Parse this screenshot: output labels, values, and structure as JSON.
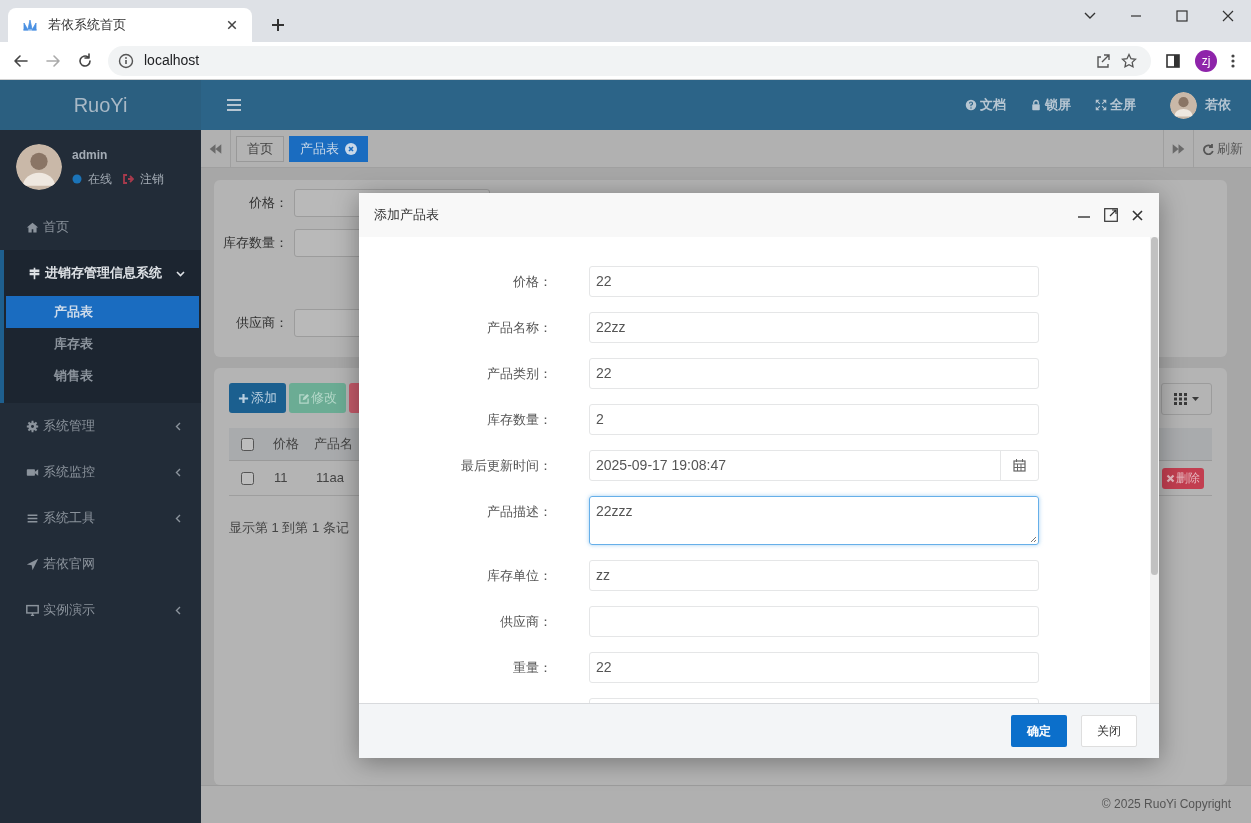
{
  "browser": {
    "tab_title": "若依系统首页",
    "url": "localhost",
    "profile_initials": "zj"
  },
  "header": {
    "logo": "RuoYi",
    "links": [
      {
        "label": "文档"
      },
      {
        "label": "锁屏"
      },
      {
        "label": "全屏"
      }
    ],
    "user_name": "若依"
  },
  "sidebar": {
    "user": {
      "name": "admin",
      "status": "在线",
      "logout": "注销"
    },
    "items": [
      {
        "kind": "link",
        "label": "首页"
      },
      {
        "kind": "menu",
        "label": "进销存管理信息系统",
        "expanded": true,
        "children": [
          {
            "label": "产品表",
            "selected": true
          },
          {
            "label": "库存表",
            "selected": false
          },
          {
            "label": "销售表",
            "selected": false
          }
        ]
      },
      {
        "kind": "menu",
        "label": "系统管理",
        "expanded": false
      },
      {
        "kind": "menu",
        "label": "系统监控",
        "expanded": false
      },
      {
        "kind": "menu",
        "label": "系统工具",
        "expanded": false
      },
      {
        "kind": "link",
        "label": "若依官网"
      },
      {
        "kind": "menu",
        "label": "实例演示",
        "expanded": false
      }
    ]
  },
  "page_tabs": [
    {
      "label": "首页",
      "selected": false,
      "closable": false
    },
    {
      "label": "产品表",
      "selected": true,
      "closable": true
    }
  ],
  "refresh": "刷新",
  "search_form": {
    "labels": [
      "价格：",
      "库存数量：",
      "供应商："
    ]
  },
  "toolbar": [
    {
      "kind": "primary",
      "label": "添加"
    },
    {
      "kind": "success",
      "label": "修改"
    },
    {
      "kind": "danger"
    }
  ],
  "table": {
    "header_checked": false,
    "columns": [
      "价格",
      "产品名"
    ],
    "rows": [
      {
        "checked": false,
        "cells": [
          "11",
          "11aa"
        ],
        "delete_label": "删除"
      }
    ]
  },
  "pagination": "显示第 1 到第 1 条记",
  "footer": "© 2025 RuoYi Copyright",
  "modal": {
    "title": "添加产品表",
    "fields": [
      {
        "kind": "text",
        "label": "价格：",
        "value": "22",
        "focused": false
      },
      {
        "kind": "text",
        "label": "产品名称：",
        "value": "22zz",
        "focused": false
      },
      {
        "kind": "text",
        "label": "产品类别：",
        "value": "22",
        "focused": false
      },
      {
        "kind": "text",
        "label": "库存数量：",
        "value": "2",
        "focused": false
      },
      {
        "kind": "date",
        "label": "最后更新时间：",
        "value": "2025-09-17 19:08:47",
        "focused": false
      },
      {
        "kind": "textarea",
        "label": "产品描述：",
        "value": "22zzz",
        "focused": true
      },
      {
        "kind": "text",
        "label": "库存单位：",
        "value": "zz",
        "focused": false
      },
      {
        "kind": "text",
        "label": "供应商：",
        "focused": false
      },
      {
        "kind": "text",
        "label": "重量：",
        "value": "22",
        "focused": false
      },
      {
        "kind": "text",
        "focused": false
      }
    ],
    "buttons": [
      {
        "kind": "primary",
        "label": "确定"
      },
      {
        "kind": "default",
        "label": "关闭"
      }
    ]
  }
}
